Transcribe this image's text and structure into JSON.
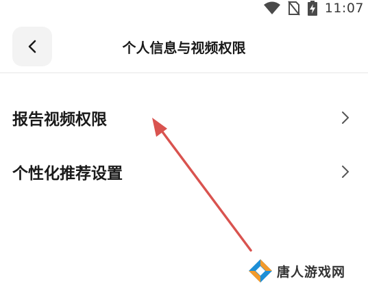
{
  "status_bar": {
    "time": "11:07",
    "icons": [
      "wifi-icon",
      "no-sim-icon",
      "battery-charging-icon"
    ]
  },
  "header": {
    "back_icon": "chevron-left-icon",
    "title": "个人信息与视频权限"
  },
  "menu": {
    "items": [
      {
        "label": "报告视频权限",
        "icon": "chevron-right-icon"
      },
      {
        "label": "个性化推荐设置",
        "icon": "chevron-right-icon"
      }
    ]
  },
  "annotation": {
    "type": "arrow",
    "color": "#d9534f"
  },
  "watermark": {
    "text": "唐人游戏网",
    "colors": [
      "#1e8fd6",
      "#f39a2b"
    ]
  }
}
